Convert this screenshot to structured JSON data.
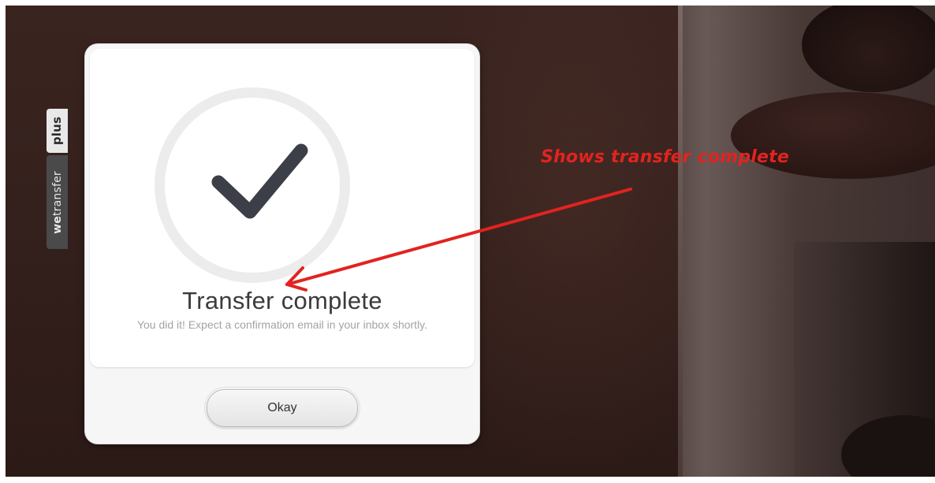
{
  "side_tabs": {
    "plus_label": "plus",
    "wetransfer_bold": "we",
    "wetransfer_rest": "transfer"
  },
  "dialog": {
    "icon": "checkmark-icon",
    "title": "Transfer complete",
    "message": "You did it! Expect a confirmation email in your inbox shortly.",
    "button_label": "Okay"
  },
  "annotation": {
    "text": "Shows transfer complete",
    "color": "#e2231f"
  },
  "colors": {
    "background": "#34201c",
    "card": "#ffffff",
    "check": "#3c3f47",
    "ring": "#ececec"
  }
}
